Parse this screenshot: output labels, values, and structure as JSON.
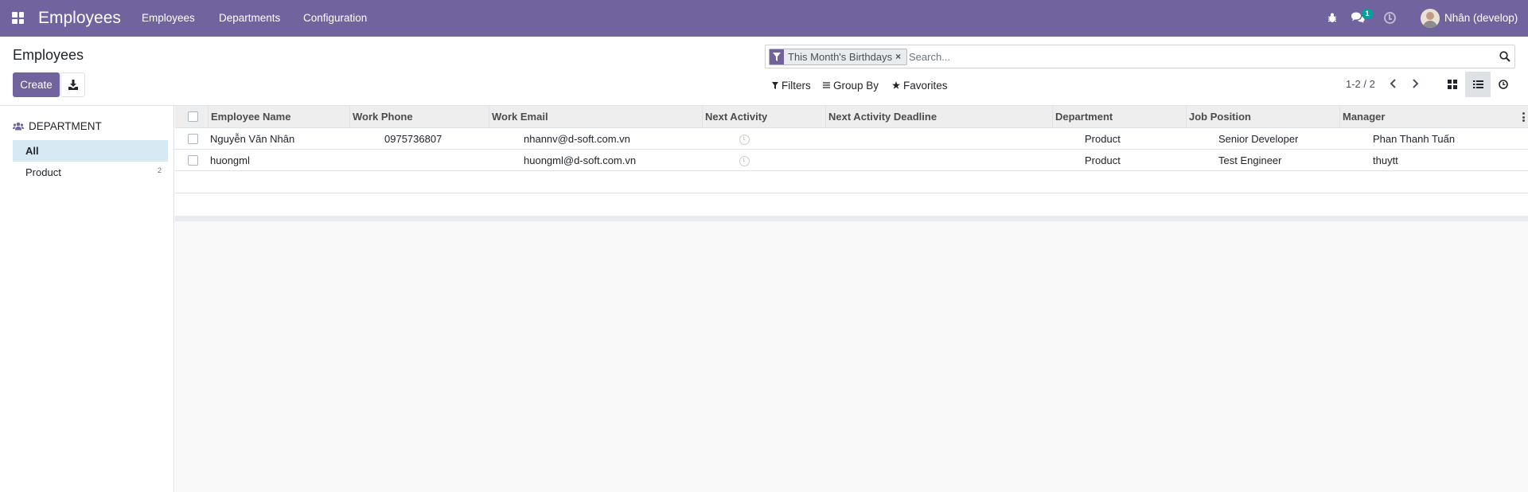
{
  "navbar": {
    "app_name": "Employees",
    "menu": [
      "Employees",
      "Departments",
      "Configuration"
    ],
    "chat_badge": "1",
    "user": "Nhân (develop)"
  },
  "control_panel": {
    "title": "Employees",
    "create_label": "Create",
    "search": {
      "facet": "This Month's Birthdays",
      "placeholder": "Search..."
    },
    "filters_label": "Filters",
    "groupby_label": "Group By",
    "favorites_label": "Favorites",
    "pager": "1-2 / 2"
  },
  "sidebar": {
    "header": "DEPARTMENT",
    "items": [
      {
        "label": "All",
        "count": ""
      },
      {
        "label": "Product",
        "count": "2"
      }
    ]
  },
  "table": {
    "columns": [
      "Employee Name",
      "Work Phone",
      "Work Email",
      "Next Activity",
      "Next Activity Deadline",
      "Department",
      "Job Position",
      "Manager"
    ],
    "rows": [
      {
        "name": "Nguyễn Văn Nhân",
        "phone": "0975736807",
        "email": "nhannv@d-soft.com.vn",
        "deadline": "",
        "department": "Product",
        "job": "Senior Developer",
        "manager": "Phan Thanh Tuấn"
      },
      {
        "name": "huongml",
        "phone": "",
        "email": "huongml@d-soft.com.vn",
        "deadline": "",
        "department": "Product",
        "job": "Test Engineer",
        "manager": "thuytt"
      }
    ]
  },
  "colors": {
    "brand": "#71639e",
    "badge": "#00a09d",
    "selected_row": "#d7eaf3"
  }
}
